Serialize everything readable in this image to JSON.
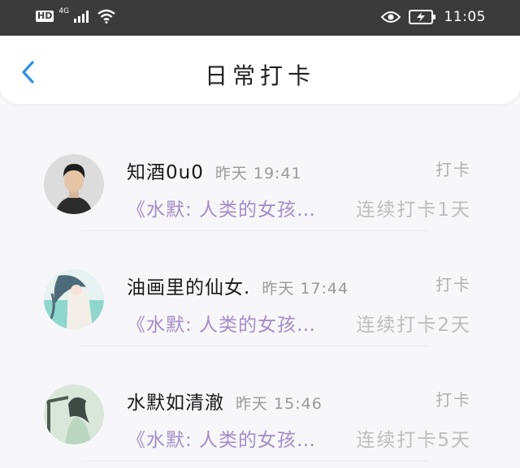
{
  "status_bar": {
    "hd": "HD",
    "network": "4G",
    "time": "11:05",
    "icons": [
      "hd-icon",
      "signal-icon",
      "wifi-icon",
      "eye-icon",
      "battery-icon"
    ]
  },
  "header": {
    "title": "日常打卡",
    "back_icon": "chevron-left-icon",
    "accent_color": "#2f8fe0"
  },
  "colors": {
    "book": "#a58cc8",
    "meta": "#9a9a9a",
    "checkin": "#b0b0b0"
  },
  "entries": [
    {
      "name": "知酒0u0",
      "time": "昨天 19:41",
      "checkin": "打卡",
      "book": "《水默: 人类的女孩…",
      "streak": "连续打卡1天"
    },
    {
      "name": "油画里的仙女.",
      "time": "昨天 17:44",
      "checkin": "打卡",
      "book": "《水默: 人类的女孩…",
      "streak": "连续打卡2天"
    },
    {
      "name": "水默如清澈",
      "time": "昨天 15:46",
      "checkin": "打卡",
      "book": "《水默: 人类的女孩…",
      "streak": "连续打卡5天"
    }
  ]
}
